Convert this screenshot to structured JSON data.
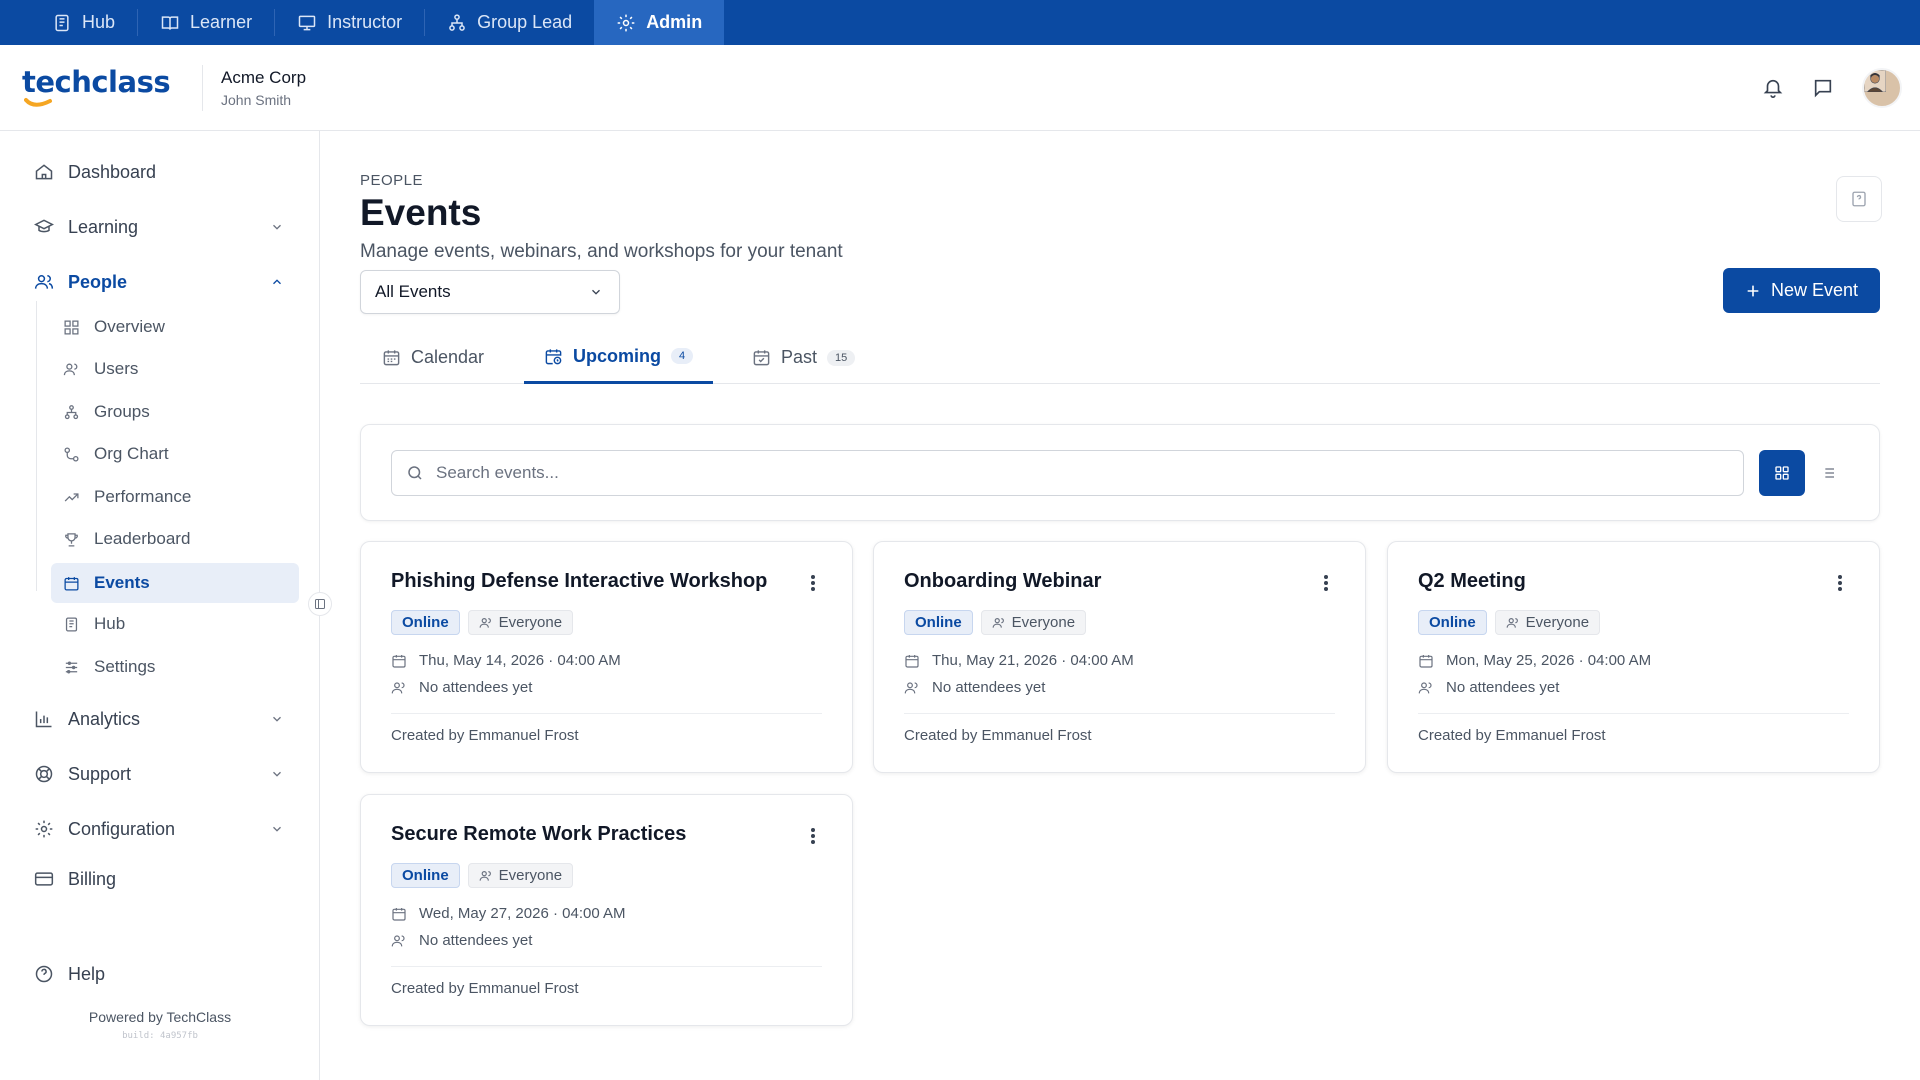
{
  "role_bar": {
    "tabs": [
      {
        "label": "Hub",
        "icon": "hub-icon"
      },
      {
        "label": "Learner",
        "icon": "book-icon"
      },
      {
        "label": "Instructor",
        "icon": "presentation-icon"
      },
      {
        "label": "Group Lead",
        "icon": "hierarchy-icon"
      },
      {
        "label": "Admin",
        "icon": "gear-icon",
        "active": true
      }
    ]
  },
  "header": {
    "logo_text": "techclass",
    "tenant_name": "Acme Corp",
    "user_name": "John Smith"
  },
  "sidebar": {
    "items": [
      {
        "label": "Dashboard"
      },
      {
        "label": "Learning"
      },
      {
        "label": "People",
        "expanded": true
      },
      {
        "label": "Analytics"
      },
      {
        "label": "Support"
      },
      {
        "label": "Configuration"
      },
      {
        "label": "Billing"
      },
      {
        "label": "Help"
      }
    ],
    "people_subitems": [
      {
        "label": "Overview"
      },
      {
        "label": "Users"
      },
      {
        "label": "Groups"
      },
      {
        "label": "Org Chart"
      },
      {
        "label": "Performance"
      },
      {
        "label": "Leaderboard"
      },
      {
        "label": "Events",
        "active": true
      },
      {
        "label": "Hub"
      },
      {
        "label": "Settings"
      }
    ],
    "powered_by": "Powered by TechClass",
    "build": "build: 4a957fb"
  },
  "main": {
    "eyebrow": "PEOPLE",
    "title": "Events",
    "subtitle": "Manage events, webinars, and workshops for your tenant",
    "filter_value": "All Events",
    "new_event_label": "New Event",
    "tabs": [
      {
        "label": "Calendar"
      },
      {
        "label": "Upcoming",
        "count": "4",
        "active": true
      },
      {
        "label": "Past",
        "count": "15"
      }
    ],
    "search_placeholder": "Search events...",
    "view_mode": "grid"
  },
  "events": [
    {
      "title": "Phishing Defense Interactive Workshop",
      "mode": "Online",
      "audience": "Everyone",
      "datetime": "Thu, May 14, 2026 · 04:00 AM",
      "attendees": "No attendees yet",
      "created_by": "Created by Emmanuel Frost"
    },
    {
      "title": "Onboarding Webinar",
      "mode": "Online",
      "audience": "Everyone",
      "datetime": "Thu, May 21, 2026 · 04:00 AM",
      "attendees": "No attendees yet",
      "created_by": "Created by Emmanuel Frost"
    },
    {
      "title": "Q2 Meeting",
      "mode": "Online",
      "audience": "Everyone",
      "datetime": "Mon, May 25, 2026 · 04:00 AM",
      "attendees": "No attendees yet",
      "created_by": "Created by Emmanuel Frost"
    },
    {
      "title": "Secure Remote Work Practices",
      "mode": "Online",
      "audience": "Everyone",
      "datetime": "Wed, May 27, 2026 · 04:00 AM",
      "attendees": "No attendees yet",
      "created_by": "Created by Emmanuel Frost"
    }
  ],
  "colors": {
    "brand": "#0b4aa2",
    "brand_light": "#e8eef8",
    "accent_logo": "#f5a623"
  }
}
